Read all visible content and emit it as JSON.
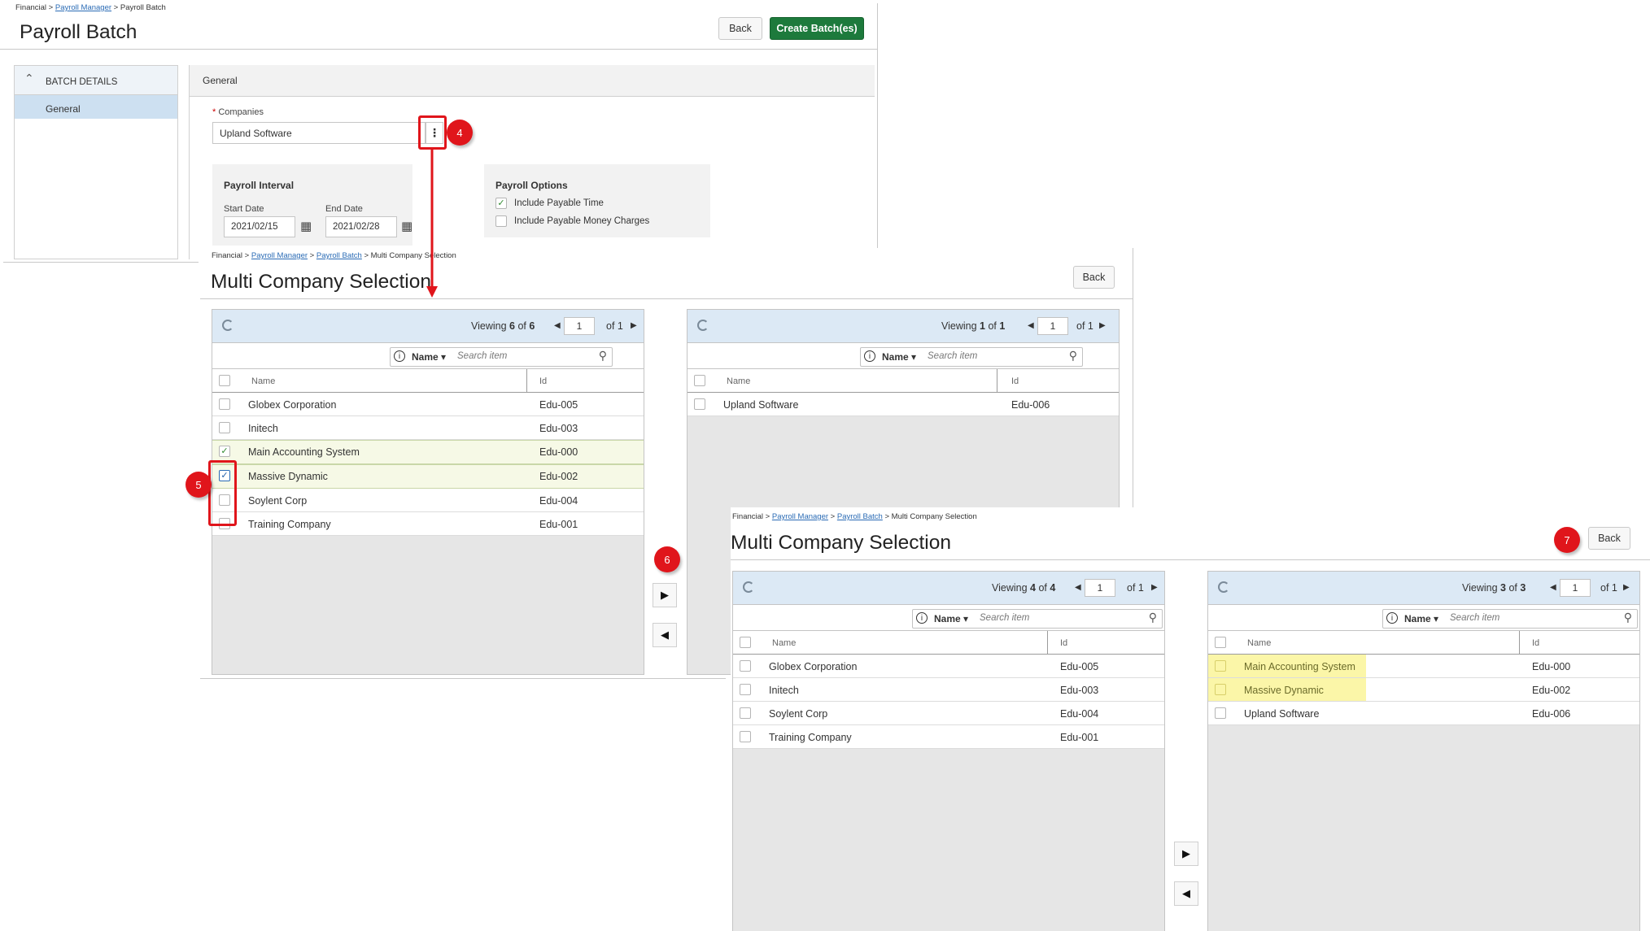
{
  "screen1": {
    "breadcrumb": {
      "root": "Financial",
      "link": "Payroll Manager",
      "current": "Payroll Batch"
    },
    "title": "Payroll Batch",
    "back_label": "Back",
    "create_label": "Create Batch(es)",
    "sidebar": {
      "section": "BATCH DETAILS",
      "item": "General"
    },
    "panel_title": "General",
    "companies": {
      "required_mark": "*",
      "label": "Companies",
      "value": "Upland Software"
    },
    "interval": {
      "title": "Payroll Interval",
      "start_label": "Start Date",
      "start_value": "2021/02/15",
      "end_label": "End Date",
      "end_value": "2021/02/28"
    },
    "options": {
      "title": "Payroll Options",
      "items": [
        {
          "label": "Include Payable Time",
          "checked": true
        },
        {
          "label": "Include Payable Money Charges",
          "checked": false
        }
      ]
    }
  },
  "screen2": {
    "breadcrumb": {
      "root": "Financial",
      "link1": "Payroll Manager",
      "link2": "Payroll Batch",
      "current": "Multi Company Selection"
    },
    "title": "Multi Company Selection",
    "back_label": "Back",
    "left": {
      "viewing": "Viewing",
      "count": "6",
      "of_word": "of",
      "total": "6",
      "page": "1",
      "pages_label": "of 1",
      "search_field": "Name",
      "search_placeholder": "Search item",
      "columns": [
        "Name",
        "Id"
      ],
      "rows": [
        {
          "name": "Globex Corporation",
          "id": "Edu-005",
          "checked": false
        },
        {
          "name": "Initech",
          "id": "Edu-003",
          "checked": false
        },
        {
          "name": "Main Accounting System",
          "id": "Edu-000",
          "checked": true
        },
        {
          "name": "Massive Dynamic",
          "id": "Edu-002",
          "checked": true
        },
        {
          "name": "Soylent Corp",
          "id": "Edu-004",
          "checked": false
        },
        {
          "name": "Training Company",
          "id": "Edu-001",
          "checked": false
        }
      ]
    },
    "right": {
      "viewing": "Viewing",
      "count": "1",
      "of_word": "of",
      "total": "1",
      "page": "1",
      "pages_label": "of 1",
      "search_field": "Name",
      "search_placeholder": "Search item",
      "columns": [
        "Name",
        "Id"
      ],
      "rows": [
        {
          "name": "Upland Software",
          "id": "Edu-006",
          "checked": false
        }
      ]
    }
  },
  "screen3": {
    "breadcrumb": {
      "root": "Financial",
      "link1": "Payroll Manager",
      "link2": "Payroll Batch",
      "current": "Multi Company Selection"
    },
    "title": "Multi Company Selection",
    "back_label": "Back",
    "left": {
      "viewing": "Viewing",
      "count": "4",
      "of_word": "of",
      "total": "4",
      "page": "1",
      "pages_label": "of 1",
      "search_field": "Name",
      "search_placeholder": "Search item",
      "columns": [
        "Name",
        "Id"
      ],
      "rows": [
        {
          "name": "Globex Corporation",
          "id": "Edu-005"
        },
        {
          "name": "Initech",
          "id": "Edu-003"
        },
        {
          "name": "Soylent Corp",
          "id": "Edu-004"
        },
        {
          "name": "Training Company",
          "id": "Edu-001"
        }
      ]
    },
    "right": {
      "viewing": "Viewing",
      "count": "3",
      "of_word": "of",
      "total": "3",
      "page": "1",
      "pages_label": "of 1",
      "search_field": "Name",
      "search_placeholder": "Search item",
      "columns": [
        "Name",
        "Id"
      ],
      "rows": [
        {
          "name": "Main Accounting System",
          "id": "Edu-000",
          "highlight": true
        },
        {
          "name": "Massive Dynamic",
          "id": "Edu-002",
          "highlight": true
        },
        {
          "name": "Upland Software",
          "id": "Edu-006",
          "highlight": false
        }
      ]
    }
  },
  "step_badges": [
    "4",
    "5",
    "6",
    "7"
  ],
  "colors": {
    "accent_green": "#1d7a3c",
    "badge_red": "#e0151b",
    "grid_toolbar": "#dce9f5",
    "highlight_yellow": "#fbf6a8"
  }
}
